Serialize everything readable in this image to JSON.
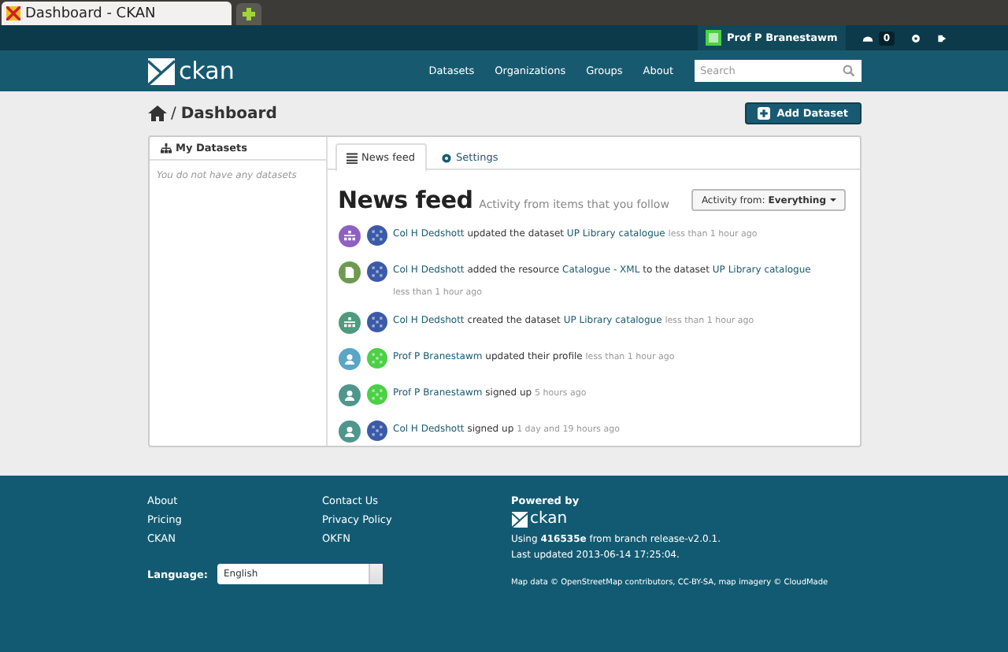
{
  "browser_tab": {
    "title": "Dashboard - CKAN"
  },
  "account": {
    "user": "Prof P Branestawm",
    "count": "0"
  },
  "nav": {
    "logo": "ckan",
    "links": [
      "Datasets",
      "Organizations",
      "Groups",
      "About"
    ],
    "search": {
      "placeholder": "Search"
    }
  },
  "breadcrumb": {
    "separator": "/",
    "title": "Dashboard"
  },
  "add_button": "Add Dataset",
  "sidebar": {
    "title": "My Datasets",
    "empty": "You do not have any datasets"
  },
  "tabs": [
    {
      "label": "News feed",
      "selected": true,
      "kind": "list"
    },
    {
      "label": "Settings",
      "selected": false,
      "kind": "gear"
    }
  ],
  "feed": {
    "title": "News feed",
    "subtitle": "Activity from items that you follow",
    "filter_label": "Activity from:",
    "filter_value": "Everything",
    "items": [
      {
        "kind": "dataset",
        "color": "#8e5fc4",
        "avatar": {
          "color": "#3b5aa8"
        },
        "parts": [
          {
            "text": "Col H Dedshott",
            "link": true
          },
          {
            "text": "updated the dataset",
            "link": false
          },
          {
            "text": "UP Library catalogue",
            "link": true
          }
        ],
        "time": "less than 1 hour ago",
        "wrap": false
      },
      {
        "kind": "resource",
        "color": "#6e9a4f",
        "avatar": {
          "color": "#3b5aa8"
        },
        "parts": [
          {
            "text": "Col H Dedshott",
            "link": true
          },
          {
            "text": "added the resource",
            "link": false
          },
          {
            "text": "Catalogue - XML",
            "link": true
          },
          {
            "text": "to the dataset",
            "link": false
          },
          {
            "text": "UP Library catalogue",
            "link": true
          }
        ],
        "time": "less than 1 hour ago",
        "wrap": true
      },
      {
        "kind": "dataset",
        "color": "#4e9b7f",
        "avatar": {
          "color": "#3b5aa8"
        },
        "parts": [
          {
            "text": "Col H Dedshott",
            "link": true
          },
          {
            "text": "created the dataset",
            "link": false
          },
          {
            "text": "UP Library catalogue",
            "link": true
          }
        ],
        "time": "less than 1 hour ago",
        "wrap": false
      },
      {
        "kind": "user",
        "color": "#5aa6c4",
        "avatar": {
          "color": "#4bd046"
        },
        "parts": [
          {
            "text": "Prof P Branestawm",
            "link": true
          },
          {
            "text": "updated their profile",
            "link": false
          }
        ],
        "time": "less than 1 hour ago",
        "wrap": false
      },
      {
        "kind": "user",
        "color": "#4f968c",
        "avatar": {
          "color": "#4bd046"
        },
        "parts": [
          {
            "text": "Prof P Branestawm",
            "link": true
          },
          {
            "text": "signed up",
            "link": false
          }
        ],
        "time": "5 hours ago",
        "wrap": false
      },
      {
        "kind": "user",
        "color": "#4f968c",
        "avatar": {
          "color": "#3b5aa8"
        },
        "parts": [
          {
            "text": "Col H Dedshott",
            "link": true
          },
          {
            "text": "signed up",
            "link": false
          }
        ],
        "time": "1 day and 19 hours ago",
        "wrap": false
      }
    ]
  },
  "footer": {
    "links_1": [
      "About",
      "Pricing",
      "CKAN"
    ],
    "links_2": [
      "Contact Us",
      "Privacy Policy",
      "OKFN"
    ],
    "language_label": "Language:",
    "language": "English",
    "powered_by": "Powered by",
    "logo": "ckan",
    "version": "Using **416535e** from branch release-v2.0.1.",
    "updated": "Last updated 2013-06-14 17:25:04.",
    "credits": "Map data © OpenStreetMap contributors, CC-BY-SA, map imagery © CloudMade"
  }
}
